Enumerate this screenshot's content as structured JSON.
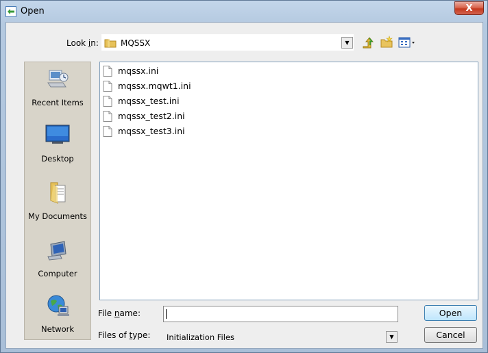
{
  "window": {
    "title": "Open",
    "close_label": "X"
  },
  "look_in": {
    "label_pre": "Look ",
    "label_key": "i",
    "label_post": "n:",
    "value": "MQSSX"
  },
  "places": [
    {
      "label": "Recent Items",
      "icon": "recent-items-icon"
    },
    {
      "label": "Desktop",
      "icon": "desktop-icon"
    },
    {
      "label": "My Documents",
      "icon": "my-documents-icon"
    },
    {
      "label": "Computer",
      "icon": "computer-icon"
    },
    {
      "label": "Network",
      "icon": "network-icon"
    }
  ],
  "files": [
    "mqssx.ini",
    "mqssx.mqwt1.ini",
    "mqssx_test.ini",
    "mqssx_test2.ini",
    "mqssx_test3.ini"
  ],
  "file_name": {
    "label_pre": "File ",
    "label_key": "n",
    "label_post": "ame:",
    "value": ""
  },
  "file_type": {
    "label_pre": "Files of ",
    "label_key": "t",
    "label_post": "ype:",
    "value": "Initialization Files"
  },
  "buttons": {
    "open": "Open",
    "cancel": "Cancel"
  }
}
